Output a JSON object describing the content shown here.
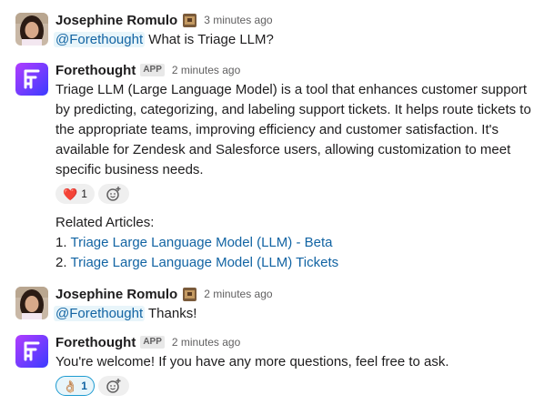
{
  "messages": [
    {
      "author": "Josephine Romulo",
      "time": "3 minutes ago",
      "mention": "@Forethought",
      "text": " What is Triage LLM?"
    },
    {
      "author": "Forethought",
      "badge": "APP",
      "time": "2 minutes ago",
      "text": "Triage LLM (Large Language Model) is a tool that enhances customer support by predicting, categorizing, and labeling support tickets. It helps route tickets to the appropriate teams, improving efficiency and customer satisfaction. It's available for Zendesk and Salesforce users, allowing customization to meet specific business needs.",
      "reaction": {
        "emoji": "❤️",
        "count": "1"
      },
      "related_title": "Related Articles:",
      "articles": [
        {
          "num": "1.",
          "title": "Triage Large Language Model (LLM) - Beta"
        },
        {
          "num": "2.",
          "title": "Triage Large Language Model (LLM) Tickets"
        }
      ]
    },
    {
      "author": "Josephine Romulo",
      "time": "2 minutes ago",
      "mention": "@Forethought",
      "text": " Thanks!"
    },
    {
      "author": "Forethought",
      "badge": "APP",
      "time": "2 minutes ago",
      "text": "You're welcome! If you have any more questions, feel free to ask.",
      "reaction": {
        "emoji": "👌🏼",
        "count": "1"
      }
    }
  ],
  "icons": {
    "user_avatar": "user-avatar-photo",
    "bot_avatar": "forethought-logo-icon",
    "status": "status-emoji-icon",
    "add_reaction": "add-reaction-icon"
  },
  "colors": {
    "link": "#1264a3",
    "mention_bg": "#e8f5fa",
    "bot_gradient_start": "#a633ff",
    "bot_gradient_end": "#3b3bff"
  }
}
